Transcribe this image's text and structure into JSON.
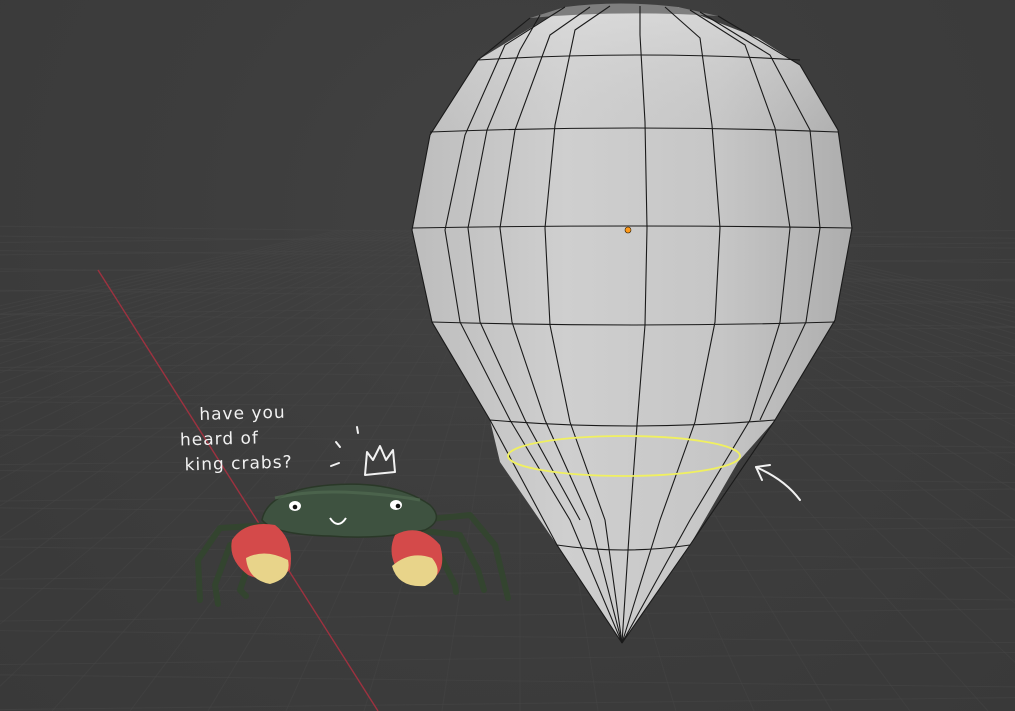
{
  "viewport": {
    "background_color": "#3d3d3d",
    "grid_color": "#474747",
    "x_axis_color": "#b03040"
  },
  "annotation": {
    "lines": [
      "have you",
      "heard of",
      "king crabs?"
    ],
    "ink_color": "#f2f2f2",
    "crown_icon": "crown-doodle-icon",
    "arrow_icon": "curved-arrow-icon"
  },
  "mesh": {
    "object": "uv-sphere-pointed-cone",
    "face_color": "#c9c9c9",
    "edge_color": "#1a1a1a",
    "selected_edge_loop_color": "#f0f060",
    "origin_dot_color": "#ff9a1a"
  },
  "crab": {
    "shell_color": "#3e5240",
    "claw_color": "#d44a4a",
    "claw_tip_color": "#e8d48a"
  }
}
